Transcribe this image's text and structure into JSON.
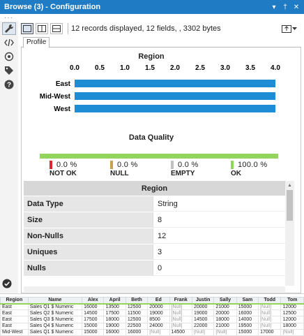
{
  "window": {
    "title": "Browse (3) - Configuration",
    "title_icons": [
      "dropdown-arrow-icon",
      "pin-icon",
      "close-icon"
    ]
  },
  "toolbar": {
    "records_text": "12 records displayed, 12 fields, , 3302 bytes"
  },
  "tabs": [
    {
      "label": "Profile"
    }
  ],
  "chart_data": {
    "type": "bar",
    "title": "Region",
    "categories": [
      "East",
      "Mid-West",
      "West"
    ],
    "values": [
      4,
      4,
      4
    ],
    "xlim": [
      0,
      4
    ],
    "xticks": [
      "0.0",
      "0.5",
      "1.0",
      "1.5",
      "2.0",
      "2.5",
      "3.0",
      "3.5",
      "4.0"
    ],
    "orientation": "horizontal",
    "bar_color": "#1f8dd6"
  },
  "quality": {
    "title": "Data Quality",
    "items": [
      {
        "label": "NOT OK",
        "pct": "0.0 %",
        "color": "#e8212f"
      },
      {
        "label": "NULL",
        "pct": "0.0 %",
        "color": "#c8a24e"
      },
      {
        "label": "EMPTY",
        "pct": "0.0 %",
        "color": "#c0c0c0"
      },
      {
        "label": "OK",
        "pct": "100.0 %",
        "color": "#93d45c"
      }
    ]
  },
  "stats": {
    "header": "Region",
    "rows": [
      {
        "key": "Data Type",
        "value": "String"
      },
      {
        "key": "Size",
        "value": "8"
      },
      {
        "key": "Non-Nulls",
        "value": "12"
      },
      {
        "key": "Uniques",
        "value": "3"
      },
      {
        "key": "Nulls",
        "value": "0"
      }
    ]
  },
  "grid": {
    "columns": [
      "Region",
      "Name",
      "Alex",
      "April",
      "Beth",
      "Ed",
      "Frank",
      "Justin",
      "Sally",
      "Sam",
      "Todd",
      "Tom"
    ],
    "rows": [
      [
        "East",
        "Sales Q1 $ Numeric",
        "16000",
        "13500",
        "12500",
        "20000",
        "[Null]",
        "20000",
        "21000",
        "15000",
        "[Null]",
        "12000"
      ],
      [
        "East",
        "Sales Q2 $ Numeric",
        "14500",
        "17500",
        "11500",
        "19000",
        "[Null]",
        "19000",
        "20000",
        "16000",
        "[Null]",
        "12500"
      ],
      [
        "East",
        "Sales Q3 $ Numeric",
        "17500",
        "18000",
        "12500",
        "8500",
        "[Null]",
        "14500",
        "18000",
        "14000",
        "[Null]",
        "12000"
      ],
      [
        "East",
        "Sales Q4 $ Numeric",
        "15000",
        "19000",
        "22500",
        "24000",
        "[Null]",
        "22000",
        "21000",
        "19500",
        "[Null]",
        "18000"
      ],
      [
        "Mid-West",
        "Sales Q1 $ Numeric",
        "15000",
        "16000",
        "16000",
        "[Null]",
        "14500",
        "[Null]",
        "[Null]",
        "15000",
        "17000",
        "[Null]"
      ]
    ]
  }
}
